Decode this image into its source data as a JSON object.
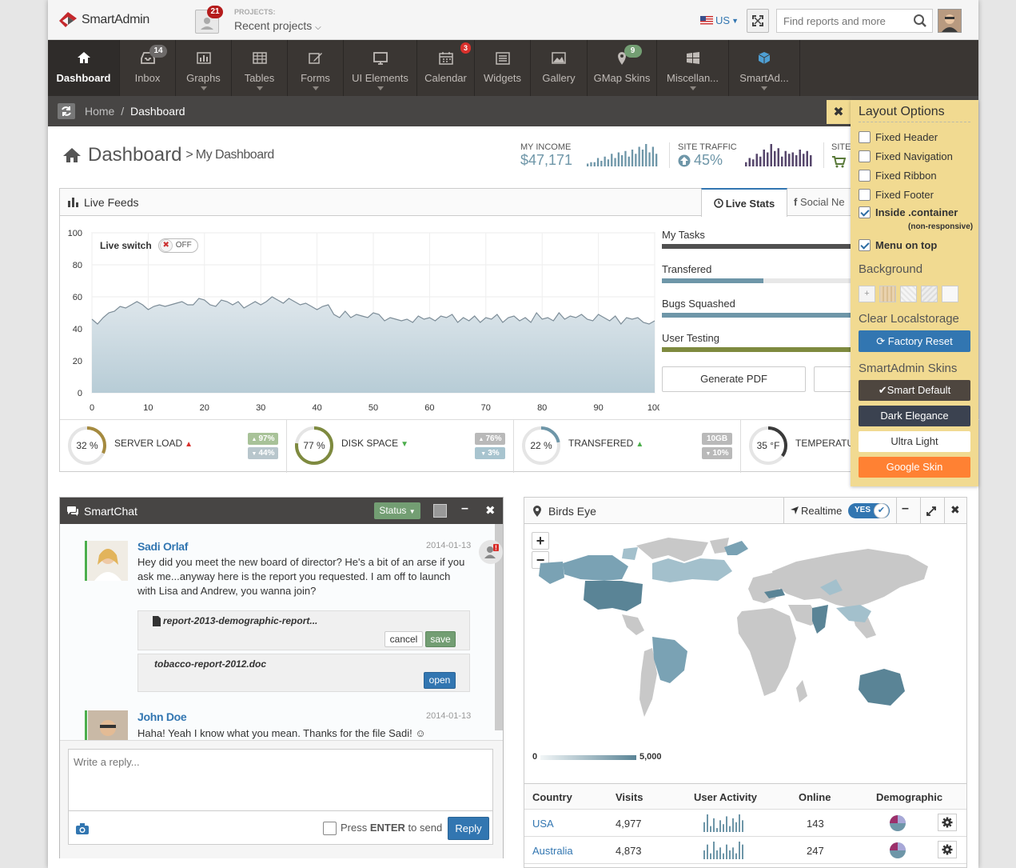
{
  "header": {
    "logo_text": "SmartAdmin",
    "projects_badge": "21",
    "projects_label": "PROJECTS:",
    "projects_value": "Recent projects",
    "lang": "US",
    "search_placeholder": "Find reports and more"
  },
  "nav": [
    {
      "label": "Dashboard",
      "icon": "home-icon",
      "badge": ""
    },
    {
      "label": "Inbox",
      "icon": "inbox-icon",
      "badge": "14"
    },
    {
      "label": "Graphs",
      "icon": "bar-chart-icon",
      "badge": ""
    },
    {
      "label": "Tables",
      "icon": "table-icon",
      "badge": ""
    },
    {
      "label": "Forms",
      "icon": "pencil-icon",
      "badge": ""
    },
    {
      "label": "UI Elements",
      "icon": "monitor-icon",
      "badge": ""
    },
    {
      "label": "Calendar",
      "icon": "calendar-icon",
      "badge": "3"
    },
    {
      "label": "Widgets",
      "icon": "list-icon",
      "badge": ""
    },
    {
      "label": "Gallery",
      "icon": "picture-icon",
      "badge": ""
    },
    {
      "label": "GMap Skins",
      "icon": "map-marker-icon",
      "badge": "9"
    },
    {
      "label": "Miscellan...",
      "icon": "windows-icon",
      "badge": ""
    },
    {
      "label": "SmartAd...",
      "icon": "cube-icon",
      "badge": ""
    }
  ],
  "breadcrumb": {
    "home": "Home",
    "sep": "/",
    "current": "Dashboard"
  },
  "page": {
    "title": "Dashboard",
    "arrow": ">",
    "subtitle": "My Dashboard"
  },
  "stats": {
    "income_label": "MY INCOME",
    "income_value": "$47,171",
    "traffic_label": "SITE TRAFFIC",
    "traffic_value": "45%",
    "third_label": "SITE"
  },
  "live_feeds": {
    "title": "Live Feeds",
    "tab_stats": "Live Stats",
    "tab_social": "Social Ne",
    "switch_label": "Live switch",
    "switch_state": "OFF",
    "progress": [
      {
        "label": "My Tasks",
        "value": 1.0,
        "color": "#505050"
      },
      {
        "label": "Transfered",
        "value": 0.54,
        "color": "#6e96a8"
      },
      {
        "label": "Bugs Squashed",
        "value": 1.0,
        "color": "#6e96a8"
      },
      {
        "label": "User Testing",
        "value": 1.0,
        "color": "#7e8a3f"
      }
    ],
    "generate_btn": "Generate PDF",
    "gauges": [
      {
        "value": "32 %",
        "label": "SERVER LOAD",
        "fill": 0.32,
        "color": "#a58a3f",
        "arrow": "up",
        "up": "97%",
        "down": "44%",
        "trend_color": "#d9302c"
      },
      {
        "value": "77 %",
        "label": "DISK SPACE",
        "fill": 0.77,
        "color": "#7e8a3f",
        "arrow": "down",
        "up": "76%",
        "down": "3%",
        "trend_color": "#4cae4c"
      },
      {
        "value": "22 %",
        "label": "TRANSFERED",
        "fill": 0.22,
        "color": "#6e96a8",
        "arrow": "up",
        "up": "10GB",
        "down": "10%",
        "trend_color": "#4cae4c"
      },
      {
        "value": "35 °F",
        "label": "TEMPERATU",
        "fill": 0.35,
        "color": "#3a3a3a",
        "arrow": "",
        "up": "",
        "down": "",
        "trend_color": "#999"
      }
    ]
  },
  "chart_data": {
    "type": "area",
    "x": [
      0,
      1,
      2,
      3,
      4,
      5,
      6,
      7,
      8,
      9,
      10,
      11,
      12,
      13,
      14,
      15,
      16,
      17,
      18,
      19,
      20,
      21,
      22,
      23,
      24,
      25,
      26,
      27,
      28,
      29,
      30,
      31,
      32,
      33,
      34,
      35,
      36,
      37,
      38,
      39,
      40,
      41,
      42,
      43,
      44,
      45,
      46,
      47,
      48,
      49,
      50,
      51,
      52,
      53,
      54,
      55,
      56,
      57,
      58,
      59,
      60,
      61,
      62,
      63,
      64,
      65,
      66,
      67,
      68,
      69,
      70,
      71,
      72,
      73,
      74,
      75,
      76,
      77,
      78,
      79,
      80,
      81,
      82,
      83,
      84,
      85,
      86,
      87,
      88,
      89,
      90,
      91,
      92,
      93,
      94,
      95,
      96,
      97,
      98,
      99,
      100
    ],
    "values": [
      46,
      43,
      47,
      50,
      51,
      54,
      53,
      55,
      57,
      55,
      52,
      54,
      55,
      54,
      55,
      56,
      57,
      55,
      55,
      59,
      58,
      55,
      54,
      58,
      57,
      55,
      57,
      53,
      55,
      57,
      55,
      57,
      60,
      58,
      56,
      59,
      57,
      55,
      56,
      54,
      52,
      54,
      55,
      49,
      47,
      51,
      47,
      49,
      48,
      47,
      50,
      49,
      45,
      47,
      46,
      45,
      46,
      44,
      48,
      46,
      47,
      45,
      48,
      47,
      49,
      44,
      47,
      45,
      48,
      44,
      47,
      46,
      49,
      44,
      47,
      48,
      45,
      47,
      44,
      50,
      46,
      47,
      45,
      50,
      46,
      48,
      47,
      49,
      46,
      45,
      49,
      47,
      45,
      48,
      43,
      47,
      46,
      47,
      44,
      43,
      45
    ],
    "xlim": [
      0,
      100
    ],
    "ylim": [
      0,
      100
    ],
    "xticks": [
      0,
      10,
      20,
      30,
      40,
      50,
      60,
      70,
      80,
      90,
      100
    ],
    "yticks": [
      0,
      20,
      40,
      60,
      80,
      100
    ]
  },
  "chat": {
    "title": "SmartChat",
    "status_btn": "Status",
    "messages": [
      {
        "name": "Sadi Orlaf",
        "date": "2014-01-13",
        "text": "Hey did you meet the new board of director? He's a bit of an arse if you ask me...anyway here is the report you requested. I am off to launch with Lisa and Andrew, you wanna join?"
      },
      {
        "name": "John Doe",
        "date": "2014-01-13",
        "text": "Haha! Yeah I know what you mean. Thanks for the file Sadi! ☺"
      }
    ],
    "file1": "report-2013-demographic-report...",
    "cancel": "cancel",
    "save": "save",
    "file2": "tobacco-report-2012.doc",
    "open": "open",
    "reply_placeholder": "Write a reply...",
    "press_enter": "Press",
    "enter": "ENTER",
    "to_send": "to send",
    "reply_btn": "Reply"
  },
  "birds_eye": {
    "title": "Birds Eye",
    "realtime": "Realtime",
    "toggle": "YES",
    "zoom_in": "+",
    "zoom_out": "−",
    "legend_min": "0",
    "legend_max": "5,000",
    "columns": [
      "Country",
      "Visits",
      "User Activity",
      "Online",
      "Demographic"
    ],
    "rows": [
      {
        "country": "USA",
        "visits": "4,977",
        "online": "143"
      },
      {
        "country": "Australia",
        "visits": "4,873",
        "online": "247"
      }
    ]
  },
  "layout_options": {
    "title": "Layout Options",
    "options": [
      {
        "label": "Fixed Header",
        "checked": false
      },
      {
        "label": "Fixed Navigation",
        "checked": false
      },
      {
        "label": "Fixed Ribbon",
        "checked": false
      },
      {
        "label": "Fixed Footer",
        "checked": false
      },
      {
        "label": "Inside .container",
        "checked": true
      },
      {
        "label": "Menu on top",
        "checked": true
      }
    ],
    "non_responsive": "(non-responsive)",
    "background": "Background",
    "clear": "Clear Localstorage",
    "factory": "Factory Reset",
    "skins_title": "SmartAdmin Skins",
    "skins": [
      {
        "label": "Smart Default",
        "bg": "#4e463f",
        "fg": "#ffffff"
      },
      {
        "label": "Dark Elegance",
        "bg": "#3b4250",
        "fg": "#ffffff"
      },
      {
        "label": "Ultra Light",
        "bg": "#ffffff",
        "fg": "#333333"
      },
      {
        "label": "Google Skin",
        "bg": "#ff8133",
        "fg": "#ffffff"
      }
    ]
  }
}
